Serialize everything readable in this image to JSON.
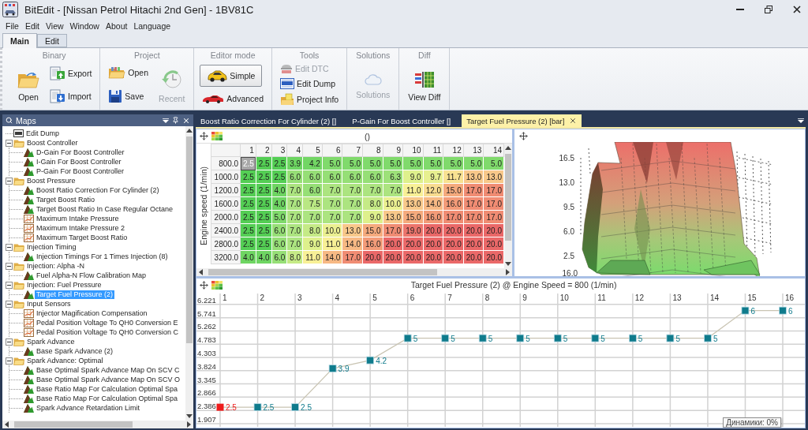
{
  "window": {
    "title": "BitEdit - [Nissan Petrol Hitachi 2nd Gen] - 1BV81C"
  },
  "menu": [
    "File",
    "Edit",
    "View",
    "Window",
    "About",
    "Language"
  ],
  "ribbon": {
    "tabs": [
      {
        "label": "Main",
        "selected": true
      },
      {
        "label": "Edit",
        "selected": false
      }
    ],
    "groups": [
      {
        "title": "Binary",
        "columns": [
          [
            {
              "label": "Open",
              "kind": "large",
              "disabled": false,
              "selected": false
            }
          ],
          [
            {
              "label": "Export",
              "kind": "small",
              "disabled": false,
              "selected": false
            },
            {
              "label": "Import",
              "kind": "small",
              "disabled": false,
              "selected": false
            }
          ]
        ]
      },
      {
        "title": "Project",
        "columns": [
          [
            {
              "label": "Open",
              "kind": "small",
              "disabled": false,
              "selected": false
            },
            {
              "label": "Save",
              "kind": "small",
              "disabled": false,
              "selected": false
            }
          ],
          [
            {
              "label": "Recent",
              "kind": "large",
              "disabled": true,
              "selected": false
            }
          ]
        ]
      },
      {
        "title": "Editor mode",
        "columns": [
          [
            {
              "label": "Simple",
              "kind": "small",
              "disabled": false,
              "selected": true
            },
            {
              "label": "Advanced",
              "kind": "small",
              "disabled": false,
              "selected": false
            }
          ]
        ]
      },
      {
        "title": "Tools",
        "columns": [
          [
            {
              "label": "Edit DTC",
              "kind": "small",
              "disabled": true,
              "selected": false
            },
            {
              "label": "Edit Dump",
              "kind": "small",
              "disabled": false,
              "selected": false
            },
            {
              "label": "Project Info",
              "kind": "small",
              "disabled": false,
              "selected": false
            }
          ]
        ]
      },
      {
        "title": "Solutions",
        "columns": [
          [
            {
              "label": "Solutions",
              "kind": "large",
              "disabled": true,
              "selected": false
            }
          ]
        ]
      },
      {
        "title": "Diff",
        "columns": [
          [
            {
              "label": "View Diff",
              "kind": "large",
              "disabled": false,
              "selected": false
            }
          ]
        ]
      }
    ]
  },
  "maps_panel": {
    "title": "Maps",
    "tree": [
      {
        "label": "Edit Dump",
        "kind": "dump",
        "selected": false
      },
      {
        "label": "Boost Controller",
        "kind": "folder",
        "expanded": true,
        "selected": false,
        "children": [
          {
            "label": "D-Gain For Boost Controller",
            "kind": "map_3d",
            "selected": false
          },
          {
            "label": "I-Gain For Boost Controller",
            "kind": "map_3d",
            "selected": false
          },
          {
            "label": "P-Gain For Boost Controller",
            "kind": "map_3d",
            "selected": false
          }
        ]
      },
      {
        "label": "Boost Pressure",
        "kind": "folder",
        "expanded": true,
        "selected": false,
        "children": [
          {
            "label": "Boost Ratio Correction For Cylinder (2)",
            "kind": "map_3d",
            "selected": false
          },
          {
            "label": "Target Boost Ratio",
            "kind": "map_3d",
            "selected": false
          },
          {
            "label": "Target Boost Ratio In Case Regular Octane",
            "kind": "map_3d",
            "selected": false
          },
          {
            "label": "Maximum Intake Pressure",
            "kind": "map_2d",
            "selected": false
          },
          {
            "label": "Maximum Intake Pressure 2",
            "kind": "map_2d",
            "selected": false
          },
          {
            "label": "Maximum Target Boost Ratio",
            "kind": "map_2d",
            "selected": false
          }
        ]
      },
      {
        "label": "Injection Timing",
        "kind": "folder",
        "expanded": true,
        "selected": false,
        "children": [
          {
            "label": "Injection Timings For 1 Times Injection (8)",
            "kind": "map_3d",
            "selected": false
          }
        ]
      },
      {
        "label": "Injection: Alpha -N",
        "kind": "folder",
        "expanded": true,
        "selected": false,
        "children": [
          {
            "label": "Fuel Alpha-N Flow Calibration Map",
            "kind": "map_3d",
            "selected": false
          }
        ]
      },
      {
        "label": "Injection: Fuel Pressure",
        "kind": "folder",
        "expanded": true,
        "selected": false,
        "children": [
          {
            "label": "Target Fuel Pressure (2)",
            "kind": "map_3d",
            "selected": true
          }
        ]
      },
      {
        "label": "Input Sensors",
        "kind": "folder",
        "expanded": true,
        "selected": false,
        "children": [
          {
            "label": "Injector Magification Compensation",
            "kind": "map_2d",
            "selected": false
          },
          {
            "label": "Pedal Position Voltage To QH0 Conversion E",
            "kind": "map_2d",
            "selected": false
          },
          {
            "label": "Pedal Position Voltage To QH0 Conversion C",
            "kind": "map_2d",
            "selected": false
          }
        ]
      },
      {
        "label": "Spark Advance",
        "kind": "folder",
        "expanded": true,
        "selected": false,
        "children": [
          {
            "label": "Base Spark Advance (2)",
            "kind": "map_3d",
            "selected": false
          }
        ]
      },
      {
        "label": "Spark Advance: Optimal",
        "kind": "folder",
        "expanded": true,
        "selected": false,
        "children": [
          {
            "label": "Base Optimal Spark Advance Map On SCV C",
            "kind": "map_3d",
            "selected": false
          },
          {
            "label": "Base Optimal Spark Advance Map On SCV O",
            "kind": "map_3d",
            "selected": false
          },
          {
            "label": "Base Ratio Map For Calculation Optimal Spa",
            "kind": "map_3d",
            "selected": false
          },
          {
            "label": "Base Ratio Map For Calculation Optimal Spa",
            "kind": "map_3d",
            "selected": false
          },
          {
            "label": "Spark Advance Retardation Limit",
            "kind": "map_3d",
            "selected": false
          }
        ]
      }
    ]
  },
  "documents": {
    "tabs": [
      {
        "label": "Boost Ratio Correction For Cylinder (2) []",
        "selected": false
      },
      {
        "label": "P-Gain For Boost Controller []",
        "selected": false
      },
      {
        "label": "Target Fuel Pressure (2) [bar]",
        "selected": true
      }
    ]
  },
  "table": {
    "column_axis": "()",
    "row_axis": "Engine speed (1/min)",
    "columns": [
      "1",
      "2",
      "3",
      "4",
      "5",
      "6",
      "7",
      "8",
      "9",
      "10",
      "11",
      "12",
      "13",
      "14"
    ],
    "rows": [
      {
        "label": "800.0",
        "cells": [
          {
            "value": "2.5",
            "selected": true
          },
          {
            "value": "2.5",
            "selected": false
          },
          {
            "value": "2.5",
            "selected": false
          },
          {
            "value": "3.9",
            "selected": false
          },
          {
            "value": "4.2",
            "selected": false
          },
          {
            "value": "5.0",
            "selected": false
          },
          {
            "value": "5.0",
            "selected": false
          },
          {
            "value": "5.0",
            "selected": false
          },
          {
            "value": "5.0",
            "selected": false
          },
          {
            "value": "5.0",
            "selected": false
          },
          {
            "value": "5.0",
            "selected": false
          },
          {
            "value": "5.0",
            "selected": false
          },
          {
            "value": "5.0",
            "selected": false
          },
          {
            "value": "5.0",
            "selected": false
          }
        ]
      },
      {
        "label": "1000.0",
        "cells": [
          {
            "value": "2.5",
            "selected": false
          },
          {
            "value": "2.5",
            "selected": false
          },
          {
            "value": "2.5",
            "selected": false
          },
          {
            "value": "6.0",
            "selected": false
          },
          {
            "value": "6.0",
            "selected": false
          },
          {
            "value": "6.0",
            "selected": false
          },
          {
            "value": "6.0",
            "selected": false
          },
          {
            "value": "6.0",
            "selected": false
          },
          {
            "value": "6.3",
            "selected": false
          },
          {
            "value": "9.0",
            "selected": false
          },
          {
            "value": "9.7",
            "selected": false
          },
          {
            "value": "11.7",
            "selected": false
          },
          {
            "value": "13.0",
            "selected": false
          },
          {
            "value": "13.0",
            "selected": false
          }
        ]
      },
      {
        "label": "1200.0",
        "cells": [
          {
            "value": "2.5",
            "selected": false
          },
          {
            "value": "2.5",
            "selected": false
          },
          {
            "value": "4.0",
            "selected": false
          },
          {
            "value": "7.0",
            "selected": false
          },
          {
            "value": "6.0",
            "selected": false
          },
          {
            "value": "7.0",
            "selected": false
          },
          {
            "value": "7.0",
            "selected": false
          },
          {
            "value": "7.0",
            "selected": false
          },
          {
            "value": "7.0",
            "selected": false
          },
          {
            "value": "11.0",
            "selected": false
          },
          {
            "value": "12.0",
            "selected": false
          },
          {
            "value": "15.0",
            "selected": false
          },
          {
            "value": "17.0",
            "selected": false
          },
          {
            "value": "17.0",
            "selected": false
          }
        ]
      },
      {
        "label": "1600.0",
        "cells": [
          {
            "value": "2.5",
            "selected": false
          },
          {
            "value": "2.5",
            "selected": false
          },
          {
            "value": "4.0",
            "selected": false
          },
          {
            "value": "7.0",
            "selected": false
          },
          {
            "value": "7.5",
            "selected": false
          },
          {
            "value": "7.0",
            "selected": false
          },
          {
            "value": "7.0",
            "selected": false
          },
          {
            "value": "8.0",
            "selected": false
          },
          {
            "value": "10.0",
            "selected": false
          },
          {
            "value": "13.0",
            "selected": false
          },
          {
            "value": "14.0",
            "selected": false
          },
          {
            "value": "16.0",
            "selected": false
          },
          {
            "value": "17.0",
            "selected": false
          },
          {
            "value": "17.0",
            "selected": false
          }
        ]
      },
      {
        "label": "2000.0",
        "cells": [
          {
            "value": "2.5",
            "selected": false
          },
          {
            "value": "2.5",
            "selected": false
          },
          {
            "value": "5.0",
            "selected": false
          },
          {
            "value": "7.0",
            "selected": false
          },
          {
            "value": "7.0",
            "selected": false
          },
          {
            "value": "7.0",
            "selected": false
          },
          {
            "value": "7.0",
            "selected": false
          },
          {
            "value": "9.0",
            "selected": false
          },
          {
            "value": "13.0",
            "selected": false
          },
          {
            "value": "15.0",
            "selected": false
          },
          {
            "value": "16.0",
            "selected": false
          },
          {
            "value": "17.0",
            "selected": false
          },
          {
            "value": "17.0",
            "selected": false
          },
          {
            "value": "17.0",
            "selected": false
          }
        ]
      },
      {
        "label": "2400.0",
        "cells": [
          {
            "value": "2.5",
            "selected": false
          },
          {
            "value": "2.5",
            "selected": false
          },
          {
            "value": "6.0",
            "selected": false
          },
          {
            "value": "7.0",
            "selected": false
          },
          {
            "value": "8.0",
            "selected": false
          },
          {
            "value": "10.0",
            "selected": false
          },
          {
            "value": "13.0",
            "selected": false
          },
          {
            "value": "15.0",
            "selected": false
          },
          {
            "value": "17.0",
            "selected": false
          },
          {
            "value": "19.0",
            "selected": false
          },
          {
            "value": "20.0",
            "selected": false
          },
          {
            "value": "20.0",
            "selected": false
          },
          {
            "value": "20.0",
            "selected": false
          },
          {
            "value": "20.0",
            "selected": false
          }
        ]
      },
      {
        "label": "2800.0",
        "cells": [
          {
            "value": "2.5",
            "selected": false
          },
          {
            "value": "2.5",
            "selected": false
          },
          {
            "value": "6.0",
            "selected": false
          },
          {
            "value": "7.0",
            "selected": false
          },
          {
            "value": "9.0",
            "selected": false
          },
          {
            "value": "11.0",
            "selected": false
          },
          {
            "value": "14.0",
            "selected": false
          },
          {
            "value": "16.0",
            "selected": false
          },
          {
            "value": "20.0",
            "selected": false
          },
          {
            "value": "20.0",
            "selected": false
          },
          {
            "value": "20.0",
            "selected": false
          },
          {
            "value": "20.0",
            "selected": false
          },
          {
            "value": "20.0",
            "selected": false
          },
          {
            "value": "20.0",
            "selected": false
          }
        ]
      },
      {
        "label": "3200.0",
        "cells": [
          {
            "value": "4.0",
            "selected": false
          },
          {
            "value": "4.0",
            "selected": false
          },
          {
            "value": "6.0",
            "selected": false
          },
          {
            "value": "8.0",
            "selected": false
          },
          {
            "value": "11.0",
            "selected": false
          },
          {
            "value": "14.0",
            "selected": false
          },
          {
            "value": "17.0",
            "selected": false
          },
          {
            "value": "20.0",
            "selected": false
          },
          {
            "value": "20.0",
            "selected": false
          },
          {
            "value": "20.0",
            "selected": false
          },
          {
            "value": "20.0",
            "selected": false
          },
          {
            "value": "20.0",
            "selected": false
          },
          {
            "value": "20.0",
            "selected": false
          },
          {
            "value": "20.0",
            "selected": false
          }
        ]
      }
    ]
  },
  "surface_plot": {
    "z_ticks": [
      "16.5",
      "13.0",
      "9.5",
      "6.0",
      "2.5"
    ],
    "y_ticks": [
      "16.0"
    ]
  },
  "line_chart": {
    "chart_data": {
      "type": "line",
      "title": "Target Fuel Pressure (2) @ Engine Speed = 800 (1/min)",
      "categories": [
        "1",
        "2",
        "3",
        "4",
        "5",
        "6",
        "7",
        "8",
        "9",
        "10",
        "11",
        "12",
        "13",
        "14",
        "15",
        "16"
      ],
      "series": [
        {
          "color": "#0f7b8c",
          "marker": "square",
          "values": [
            2.5,
            2.5,
            2.5,
            3.9,
            4.2,
            5,
            5,
            5,
            5,
            5,
            5,
            5,
            5,
            5,
            6,
            6
          ]
        }
      ],
      "ylim": [
        1.79,
        7.16
      ],
      "yticks": [
        6.221,
        5.741,
        5.262,
        4.783,
        4.303,
        3.824,
        3.345,
        2.866,
        2.386,
        1.907
      ],
      "grid": true,
      "data_labels": true
    }
  },
  "tooltip": "Динамики: 0%"
}
